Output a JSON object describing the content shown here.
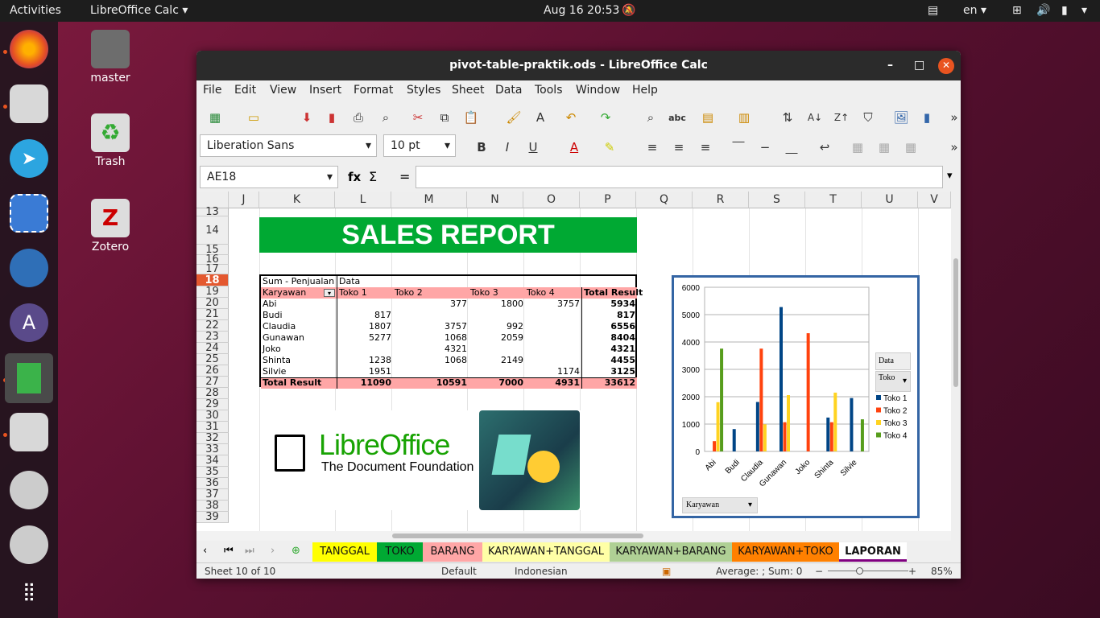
{
  "topbar": {
    "activities": "Activities",
    "app": "LibreOffice Calc",
    "datetime": "Aug 16  20:53",
    "lang": "en"
  },
  "desktop": {
    "icons": [
      {
        "label": "master"
      },
      {
        "label": "Trash"
      },
      {
        "label": "Zotero"
      }
    ]
  },
  "window": {
    "title": "pivot-table-praktik.ods - LibreOffice Calc"
  },
  "menu": [
    "File",
    "Edit",
    "View",
    "Insert",
    "Format",
    "Styles",
    "Sheet",
    "Data",
    "Tools",
    "Window",
    "Help"
  ],
  "format": {
    "font": "Liberation Sans",
    "size": "10 pt"
  },
  "formula": {
    "name_box": "AE18",
    "fx": "fx",
    "sigma": "Σ",
    "eq": "="
  },
  "columns": [
    "J",
    "K",
    "L",
    "M",
    "N",
    "O",
    "P",
    "Q",
    "R",
    "S",
    "T",
    "U",
    "V"
  ],
  "rows": [
    "13",
    "14",
    "15",
    "16",
    "17",
    "18",
    "19",
    "20",
    "21",
    "22",
    "23",
    "24",
    "25",
    "26",
    "27",
    "28",
    "29",
    "30",
    "31",
    "32",
    "33",
    "34",
    "35",
    "36",
    "37",
    "38",
    "39"
  ],
  "sales_title": "SALES REPORT",
  "pivot": {
    "corner": "Sum - Penjualan",
    "data_label": "Data",
    "row_field": "Karyawan",
    "headers": [
      "Toko 1",
      "Toko 2",
      "Toko 3",
      "Toko 4",
      "Total Result"
    ],
    "rows": [
      {
        "name": "Abi",
        "v": [
          "",
          "377",
          "1800",
          "3757",
          "5934"
        ]
      },
      {
        "name": "Budi",
        "v": [
          "817",
          "",
          "",
          "",
          "817"
        ]
      },
      {
        "name": "Claudia",
        "v": [
          "1807",
          "3757",
          "992",
          "",
          "6556"
        ]
      },
      {
        "name": "Gunawan",
        "v": [
          "5277",
          "1068",
          "2059",
          "",
          "8404"
        ]
      },
      {
        "name": "Joko",
        "v": [
          "",
          "4321",
          "",
          "",
          "4321"
        ]
      },
      {
        "name": "Shinta",
        "v": [
          "1238",
          "1068",
          "2149",
          "",
          "4455"
        ]
      },
      {
        "name": "Silvie",
        "v": [
          "1951",
          "",
          "",
          "1174",
          "3125"
        ]
      }
    ],
    "total": {
      "name": "Total Result",
      "v": [
        "11090",
        "10591",
        "7000",
        "4931",
        "33612"
      ]
    }
  },
  "logo": {
    "name": "LibreOffice",
    "sub": "The Document Foundation"
  },
  "chart_data": {
    "type": "bar",
    "categories": [
      "Abi",
      "Budi",
      "Claudia",
      "Gunawan",
      "Joko",
      "Shinta",
      "Silvie"
    ],
    "series": [
      {
        "name": "Toko 1",
        "color": "#004586",
        "values": [
          0,
          817,
          1807,
          5277,
          0,
          1238,
          1951
        ]
      },
      {
        "name": "Toko 2",
        "color": "#ff420e",
        "values": [
          377,
          0,
          3757,
          1068,
          4321,
          1068,
          0
        ]
      },
      {
        "name": "Toko 3",
        "color": "#ffd320",
        "values": [
          1800,
          0,
          992,
          2059,
          0,
          2149,
          0
        ]
      },
      {
        "name": "Toko 4",
        "color": "#579d1c",
        "values": [
          3757,
          0,
          0,
          0,
          0,
          0,
          1174
        ]
      }
    ],
    "yticks": [
      "0",
      "1000",
      "2000",
      "3000",
      "4000",
      "5000",
      "6000"
    ],
    "ylim": [
      0,
      6000
    ],
    "legend_title": "Data",
    "legend_field": "Toko",
    "row_field_button": "Karyawan"
  },
  "sheets": [
    "TANGGAL",
    "TOKO",
    "BARANG",
    "KARYAWAN+TANGGAL",
    "KARYAWAN+BARANG",
    "KARYAWAN+TOKO",
    "LAPORAN"
  ],
  "sheet_colors": [
    "#ffff00",
    "#00a933",
    "#ffa6a6",
    "#ffffa6",
    "#afd095",
    "#ff8000",
    "#efefef"
  ],
  "status": {
    "sheet": "Sheet 10 of 10",
    "style": "Default",
    "lang": "Indonesian",
    "sum": "Average: ; Sum: 0",
    "zoom": "85%"
  }
}
